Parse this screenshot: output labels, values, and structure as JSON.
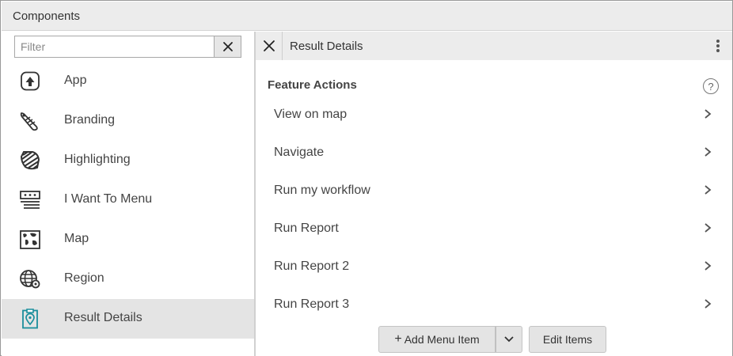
{
  "window": {
    "title": "Components"
  },
  "filter": {
    "placeholder": "Filter",
    "value": ""
  },
  "components": [
    {
      "label": "App",
      "icon": "app-upload-icon"
    },
    {
      "label": "Branding",
      "icon": "branding-brush-icon"
    },
    {
      "label": "Highlighting",
      "icon": "highlighting-icon"
    },
    {
      "label": "I Want To Menu",
      "icon": "menu-list-icon"
    },
    {
      "label": "Map",
      "icon": "map-icon"
    },
    {
      "label": "Region",
      "icon": "globe-region-icon"
    },
    {
      "label": "Result Details",
      "icon": "result-details-pin-icon",
      "selected": true
    }
  ],
  "details": {
    "title": "Result Details",
    "section_title": "Feature Actions",
    "help_symbol": "?",
    "actions": [
      {
        "label": "View on map"
      },
      {
        "label": "Navigate"
      },
      {
        "label": "Run my workflow"
      },
      {
        "label": "Run Report"
      },
      {
        "label": "Run Report 2"
      },
      {
        "label": "Run Report 3"
      }
    ],
    "add_button": {
      "plus": "+",
      "label": "Add Menu Item"
    },
    "edit_button": {
      "label": "Edit Items"
    }
  },
  "colors": {
    "accent": "#1a8e9c",
    "selected_bg": "#e4e4e4",
    "header_bg": "#ececec"
  }
}
